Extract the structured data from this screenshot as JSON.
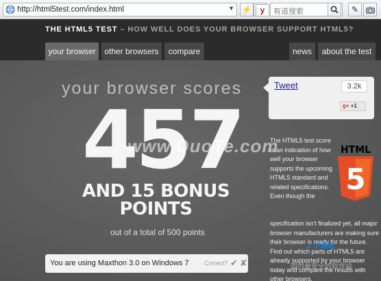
{
  "browser": {
    "url": "http://html5test.com/index.html",
    "search_placeholder": "有道搜索"
  },
  "site": {
    "title_main": "THE HTML5 TEST",
    "title_sub": " – HOW WELL DOES YOUR BROWSER SUPPORT HTML5?",
    "nav_left": [
      "your browser",
      "other browsers",
      "compare"
    ],
    "nav_right": [
      "news",
      "about the test"
    ]
  },
  "score": {
    "heading": "your browser scores",
    "value": "457",
    "bonus_line1": "AND 15 BONUS",
    "bonus_line2": "POINTS",
    "total": "out of a total of 500 points"
  },
  "user_agent": {
    "text": "You are using Maxthon 3.0 on Windows 7",
    "correct_label": "Correct?",
    "check": "✔",
    "cross": "✘"
  },
  "social": {
    "tweet_label": "Tweet",
    "tweet_count": "3.2k",
    "gplus_label": "g+",
    "gplus_count": "+1"
  },
  "description": {
    "part1": "The HTML5 test score is an indication of how well your browser supports the upcoming HTML5 standard and related specifications. Even though the",
    "part2": "specification isn't finalized yet, all major browser manufacturers are making sure their browser is ready for the future. Find out which parts of HTML5 are already supported by your browser today and compare the results with other browsers."
  },
  "logo": {
    "label": "HTML",
    "glyph": "5"
  },
  "watermarks": {
    "center": "www.DuoTe.com",
    "corner": "Z 下载站",
    "corner_cn": "国内最安全的软件站"
  },
  "colors": {
    "header_bg": "#2b2b2b",
    "main_bg": "#5b5b5b",
    "html5_orange": "#e44d26",
    "tab_active": "#6a6a6a"
  }
}
